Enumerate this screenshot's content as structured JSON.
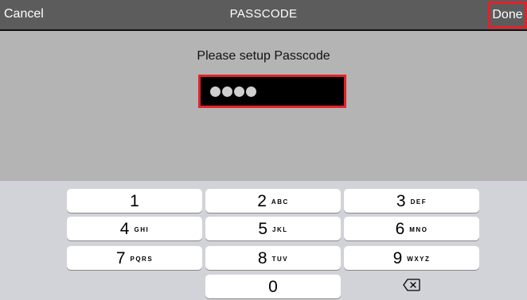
{
  "navbar": {
    "cancel_label": "Cancel",
    "title": "PASSCODE",
    "done_label": "Done"
  },
  "content": {
    "prompt": "Please setup Passcode",
    "entered_digits": 4
  },
  "keypad": {
    "keys": [
      {
        "digit": "1",
        "letters": ""
      },
      {
        "digit": "2",
        "letters": "ABC"
      },
      {
        "digit": "3",
        "letters": "DEF"
      },
      {
        "digit": "4",
        "letters": "GHI"
      },
      {
        "digit": "5",
        "letters": "JKL"
      },
      {
        "digit": "6",
        "letters": "MNO"
      },
      {
        "digit": "7",
        "letters": "PQRS"
      },
      {
        "digit": "8",
        "letters": "TUV"
      },
      {
        "digit": "9",
        "letters": "WXYZ"
      },
      {
        "digit": "0",
        "letters": ""
      }
    ],
    "delete_icon": "backspace-icon"
  },
  "colors": {
    "highlight": "#e5202a",
    "navbar": "#5c5c5c",
    "content_bg": "#b4b4b4",
    "keypad_bg": "#d1d3d8"
  }
}
